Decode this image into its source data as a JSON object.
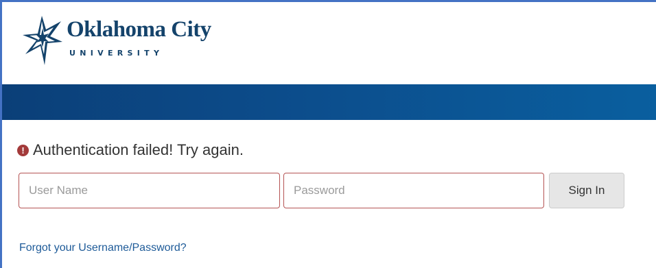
{
  "header": {
    "logo": {
      "name": "Oklahoma City",
      "subtitle": "UNIVERSITY",
      "icon": "okcu-star-logo"
    }
  },
  "banner": {
    "color_start": "#0b3f78",
    "color_end": "#0a5f9f"
  },
  "login": {
    "error": {
      "icon": "exclamation-circle-icon",
      "message": "Authentication failed! Try again.",
      "icon_color": "#a33a3a"
    },
    "username": {
      "placeholder": "User Name",
      "value": ""
    },
    "password": {
      "placeholder": "Password",
      "value": ""
    },
    "sign_in_label": "Sign In",
    "forgot_link": "Forgot your Username/Password?",
    "error_border_color": "#b45252",
    "link_color": "#1d5a98"
  }
}
